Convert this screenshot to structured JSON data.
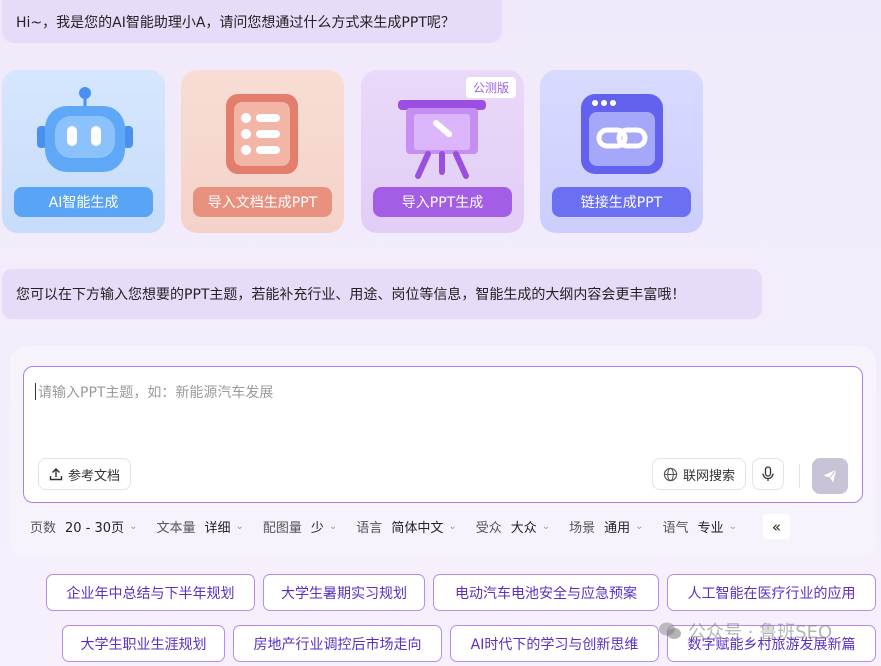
{
  "greeting": "Hi~，我是您的AI智能助理小A，请问您想通过什么方式来生成PPT呢？",
  "modes": [
    {
      "label": "AI智能生成",
      "icon": "robot-icon",
      "color": "#5aa4f5"
    },
    {
      "label": "导入文档生成PPT",
      "icon": "document-list-icon",
      "color": "#e9917f"
    },
    {
      "label": "导入PPT生成",
      "icon": "presentation-board-icon",
      "color": "#a45ee6",
      "badge": "公测版"
    },
    {
      "label": "链接生成PPT",
      "icon": "link-icon",
      "color": "#6b6ff2"
    }
  ],
  "hint": "您可以在下方输入您想要的PPT主题，若能补充行业、用途、岗位等信息，智能生成的大纲内容会更丰富哦！",
  "input": {
    "placeholder": "请输入PPT主题，如：新能源汽车发展",
    "ref_doc": "参考文档",
    "web_search": "联网搜索"
  },
  "options": [
    {
      "key": "页数",
      "value": "20 - 30页"
    },
    {
      "key": "文本量",
      "value": "详细"
    },
    {
      "key": "配图量",
      "value": "少"
    },
    {
      "key": "语言",
      "value": "简体中文"
    },
    {
      "key": "受众",
      "value": "大众"
    },
    {
      "key": "场景",
      "value": "通用"
    },
    {
      "key": "语气",
      "value": "专业"
    }
  ],
  "collapse_label": "«",
  "suggestions": [
    "企业年中总结与下半年规划",
    "大学生暑期实习规划",
    "电动汽车电池安全与应急预案",
    "人工智能在医疗行业的应用",
    "大学生职业生涯规划",
    "房地产行业调控后市场走向",
    "AI时代下的学习与创新思维",
    "数字赋能乡村旅游发展新篇"
  ],
  "watermark": "公众号 · 鲁班SEO"
}
